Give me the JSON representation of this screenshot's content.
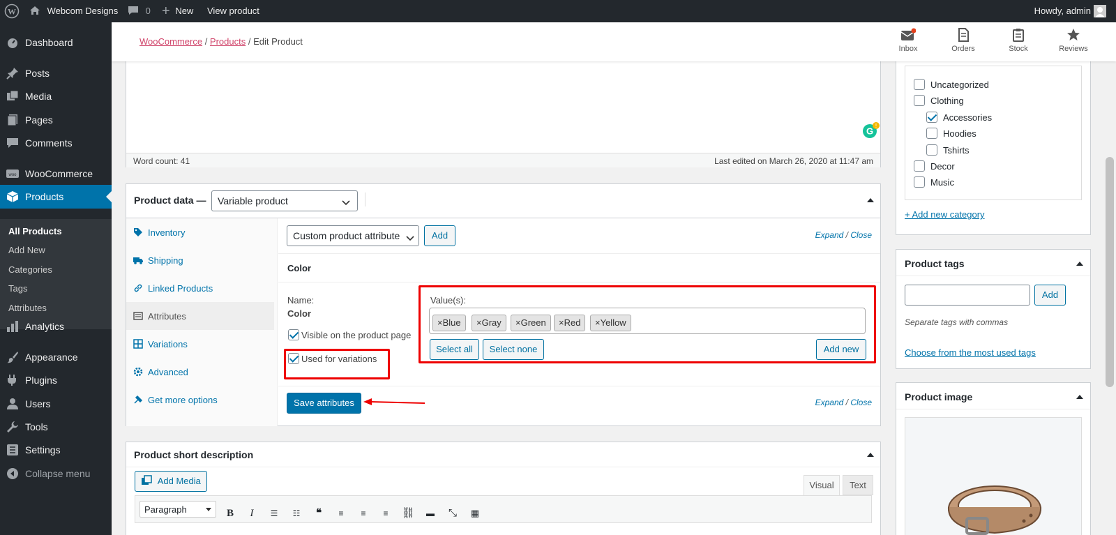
{
  "admin_bar": {
    "site_name": "Webcom Designs",
    "comments_count": "0",
    "new_label": "New",
    "view_product": "View product",
    "howdy": "Howdy, admin"
  },
  "sidebar": {
    "items": [
      {
        "label": "Dashboard",
        "icon": "dashboard-icon"
      },
      {
        "label": "Posts",
        "icon": "pin-icon"
      },
      {
        "label": "Media",
        "icon": "media-icon"
      },
      {
        "label": "Pages",
        "icon": "page-icon"
      },
      {
        "label": "Comments",
        "icon": "comment-icon"
      },
      {
        "label": "WooCommerce",
        "icon": "woocommerce-icon"
      },
      {
        "label": "Products",
        "icon": "box-icon"
      },
      {
        "label": "Analytics",
        "icon": "bar-chart-icon"
      },
      {
        "label": "Appearance",
        "icon": "brush-icon"
      },
      {
        "label": "Plugins",
        "icon": "plug-icon"
      },
      {
        "label": "Users",
        "icon": "user-icon"
      },
      {
        "label": "Tools",
        "icon": "wrench-icon"
      },
      {
        "label": "Settings",
        "icon": "settings-icon"
      },
      {
        "label": "Collapse menu",
        "icon": "collapse-icon"
      }
    ],
    "submenu": [
      "All Products",
      "Add New",
      "Categories",
      "Tags",
      "Attributes"
    ]
  },
  "header": {
    "breadcrumb": {
      "root": "WooCommerce",
      "mid": "Products",
      "current": "Edit Product"
    },
    "buttons": [
      {
        "label": "Inbox"
      },
      {
        "label": "Orders"
      },
      {
        "label": "Stock"
      },
      {
        "label": "Reviews"
      }
    ]
  },
  "editor": {
    "word_count": "Word count: 41",
    "last_edited": "Last edited on March 26, 2020 at 11:47 am"
  },
  "product_data": {
    "title": "Product data —",
    "type_selected": "Variable product",
    "tabs": [
      "Inventory",
      "Shipping",
      "Linked Products",
      "Attributes",
      "Variations",
      "Advanced",
      "Get more options"
    ],
    "attribute_select": "Custom product attribute",
    "add_label": "Add",
    "expand": "Expand",
    "close": "Close",
    "attribute_name_heading": "Color",
    "name_label": "Name:",
    "name_value": "Color",
    "visible_label": "Visible on the product page",
    "variations_label": "Used for variations",
    "values_label": "Value(s):",
    "values": [
      "Blue",
      "Gray",
      "Green",
      "Red",
      "Yellow"
    ],
    "select_all": "Select all",
    "select_none": "Select none",
    "add_new": "Add new",
    "save": "Save attributes"
  },
  "short_desc": {
    "title": "Product short description",
    "add_media": "Add Media",
    "visual": "Visual",
    "text": "Text",
    "paragraph": "Paragraph"
  },
  "categories": {
    "items": [
      {
        "label": "Uncategorized",
        "checked": false
      },
      {
        "label": "Clothing",
        "checked": false
      },
      {
        "label": "Accessories",
        "checked": true
      },
      {
        "label": "Hoodies",
        "checked": false
      },
      {
        "label": "Tshirts",
        "checked": false
      },
      {
        "label": "Decor",
        "checked": false
      },
      {
        "label": "Music",
        "checked": false
      }
    ],
    "add_new": "+ Add new category"
  },
  "tags": {
    "title": "Product tags",
    "add": "Add",
    "hint": "Separate tags with commas",
    "choose": "Choose from the most used tags"
  },
  "image": {
    "title": "Product image"
  },
  "colors": {
    "accent": "#0073aa",
    "admin_bg": "#23282d",
    "highlight": "#e00000"
  }
}
